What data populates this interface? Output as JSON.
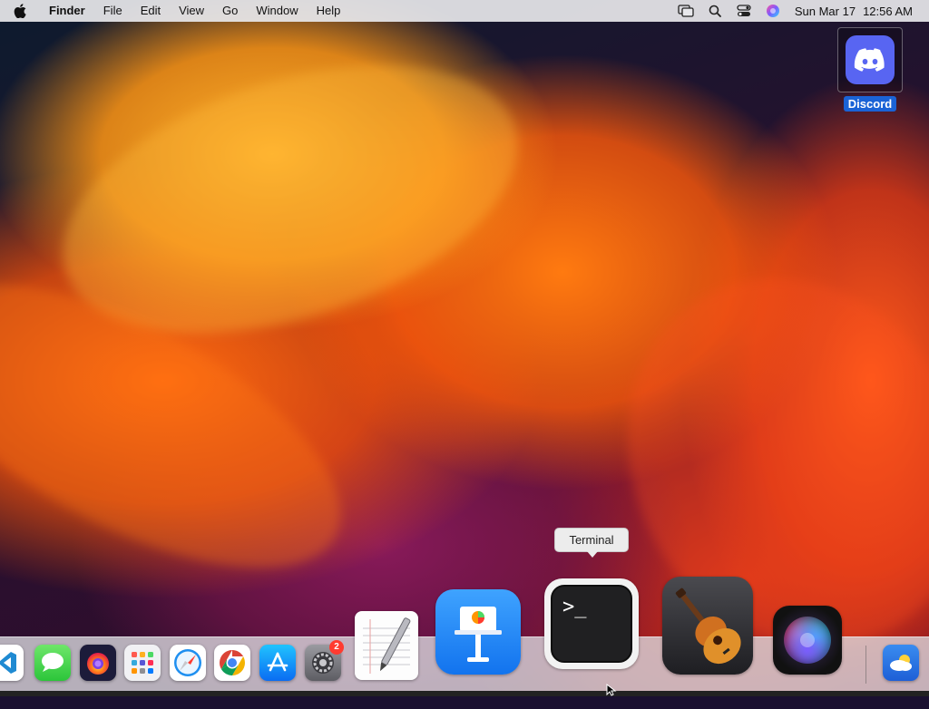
{
  "menubar": {
    "app_name": "Finder",
    "menus": [
      "File",
      "Edit",
      "View",
      "Go",
      "Window",
      "Help"
    ],
    "status_icons": [
      "screen-mirroring-icon",
      "spotlight-search-icon",
      "control-center-icon",
      "siri-icon"
    ],
    "date": "Sun Mar 17",
    "time": "12:56 AM"
  },
  "desktop": {
    "icons": [
      {
        "label": "Discord",
        "icon": "discord-icon",
        "selected": true
      }
    ]
  },
  "tooltip": {
    "text": "Terminal"
  },
  "dock": {
    "apps": [
      {
        "name": "vscode",
        "icon": "vscode-icon"
      },
      {
        "name": "messages",
        "icon": "messages-icon"
      },
      {
        "name": "firefox",
        "icon": "firefox-icon"
      },
      {
        "name": "launchpad",
        "icon": "launchpad-icon"
      },
      {
        "name": "safari",
        "icon": "safari-icon"
      },
      {
        "name": "chrome",
        "icon": "chrome-icon"
      },
      {
        "name": "app-store",
        "icon": "app-store-icon"
      },
      {
        "name": "system-settings",
        "icon": "settings-icon",
        "badge": "2"
      },
      {
        "name": "textedit",
        "icon": "textedit-icon"
      },
      {
        "name": "keynote",
        "icon": "keynote-icon"
      },
      {
        "name": "terminal",
        "icon": "terminal-icon",
        "hovered": true
      },
      {
        "name": "garageband",
        "icon": "garageband-icon"
      },
      {
        "name": "siri",
        "icon": "siri-icon"
      },
      {
        "name": "weather",
        "icon": "weather-icon"
      }
    ]
  },
  "colors": {
    "discord": "#5865f2",
    "selection": "#1a63d6",
    "badge": "#ff3b30"
  }
}
